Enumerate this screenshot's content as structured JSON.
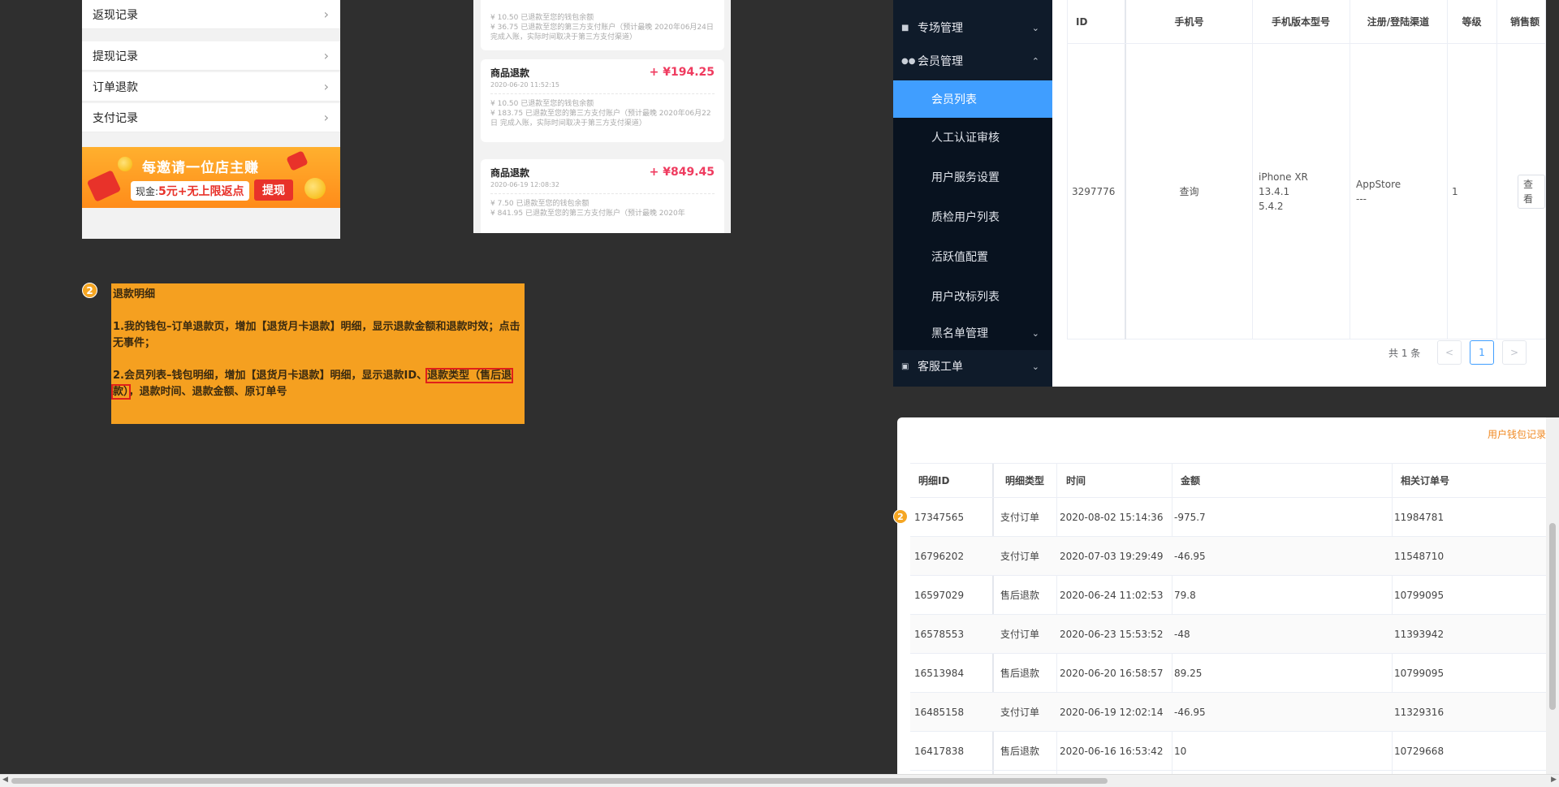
{
  "wallet_menu": {
    "items": [
      {
        "label": "返现记录"
      },
      {
        "label": "提现记录"
      },
      {
        "label": "订单退款"
      },
      {
        "label": "支付记录"
      }
    ]
  },
  "promo_banner": {
    "title": "每邀请一位店主赚",
    "cash_prefix": "现金:",
    "cash_value": "5元+无上限返点",
    "button": "提现"
  },
  "refund_cards": [
    {
      "title": "",
      "amount": "",
      "date": "",
      "lines": [
        "¥ 10.50 已退款至您的钱包余额",
        "¥ 36.75 已退款至您的第三方支付账户（预计最晚 2020年06月24日 完成入账，实际时间取决于第三方支付渠道）"
      ]
    },
    {
      "title": "商品退款",
      "amount": "+ ¥194.25",
      "date": "2020-06-20 11:52:15",
      "lines": [
        "¥ 10.50 已退款至您的钱包余额",
        "¥ 183.75 已退款至您的第三方支付账户（预计最晚 2020年06月22日 完成入账，实际时间取决于第三方支付渠道）"
      ]
    },
    {
      "title": "商品退款",
      "amount": "+ ¥849.45",
      "date": "2020-06-19 12:08:32",
      "lines": [
        "¥ 7.50 已退款至您的钱包余额",
        "¥ 841.95 已退款至您的第三方支付账户（预计最晚 2020年"
      ]
    }
  ],
  "annotation": {
    "badge": "2",
    "title": "退款明细",
    "p1": "1.我的钱包–订单退款页，增加【退货月卡退款】明细，显示退款金额和退款时效；点击无事件；",
    "p2_before": "2.会员列表–钱包明细，增加【退货月卡退款】明细，显示退款ID、",
    "p2_highlight": "退款类型（售后退款）",
    "p2_after": "，退款时间、退款金额、原订单号"
  },
  "sidebar": {
    "groups": [
      {
        "label": "专场管理",
        "icon": "list-icon"
      },
      {
        "label": "会员管理",
        "icon": "users-icon"
      },
      {
        "label": "客服工单",
        "icon": "ticket-icon"
      }
    ],
    "member_items": [
      {
        "label": "会员列表",
        "active": true
      },
      {
        "label": "人工认证审核"
      },
      {
        "label": "用户服务设置"
      },
      {
        "label": "质检用户列表"
      },
      {
        "label": "活跃值配置"
      },
      {
        "label": "用户改标列表"
      },
      {
        "label": "黑名单管理"
      }
    ]
  },
  "member_table": {
    "columns": [
      "ID",
      "手机号",
      "手机版本型号",
      "注册/登陆渠道",
      "等级",
      "销售额"
    ],
    "row": {
      "id": "3297776",
      "phone": "查询",
      "device": [
        "iPhone XR",
        "13.4.1",
        "5.4.2"
      ],
      "channel": [
        "AppStore",
        "---"
      ],
      "level": "1",
      "action": "查看"
    },
    "pagination": {
      "total": "共 1 条",
      "prev": "<",
      "current": "1",
      "next": ">"
    }
  },
  "wallet_modal": {
    "link": "用户钱包记录",
    "badge": "2",
    "columns": [
      "明细ID",
      "明细类型",
      "时间",
      "金额",
      "相关订单号"
    ],
    "rows": [
      [
        "17347565",
        "支付订单",
        "2020-08-02 15:14:36",
        "-975.7",
        "11984781"
      ],
      [
        "16796202",
        "支付订单",
        "2020-07-03 19:29:49",
        "-46.95",
        "11548710"
      ],
      [
        "16597029",
        "售后退款",
        "2020-06-24 11:02:53",
        "79.8",
        "10799095"
      ],
      [
        "16578553",
        "支付订单",
        "2020-06-23 15:53:52",
        "-48",
        "11393942"
      ],
      [
        "16513984",
        "售后退款",
        "2020-06-20 16:58:57",
        "89.25",
        "10799095"
      ],
      [
        "16485158",
        "支付订单",
        "2020-06-19 12:02:14",
        "-46.95",
        "11329316"
      ],
      [
        "16417838",
        "售后退款",
        "2020-06-16 16:53:42",
        "10",
        "10729668"
      ]
    ]
  },
  "colors": {
    "accent": "#409eff",
    "note_bg": "#f5a020",
    "highlight_box": "#e0201a",
    "refund_amount": "#ef3b5f"
  }
}
